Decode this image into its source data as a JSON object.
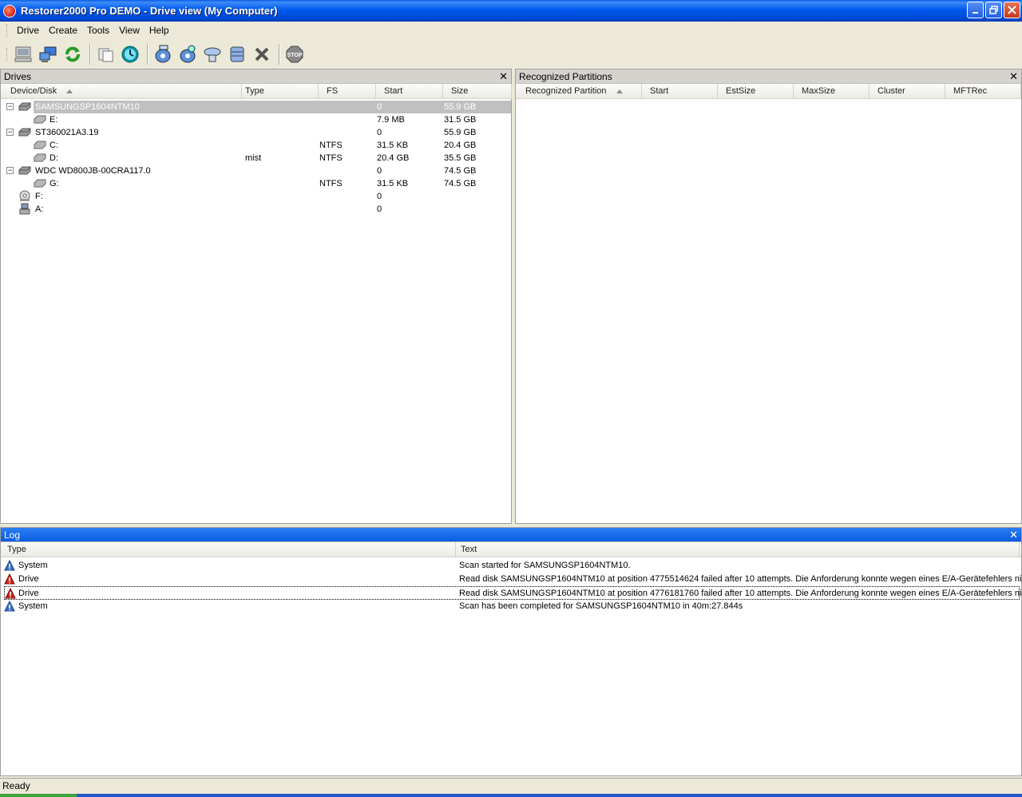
{
  "window": {
    "title": "Restorer2000 Pro DEMO - Drive view (My Computer)"
  },
  "menu": [
    "Drive",
    "Create",
    "Tools",
    "View",
    "Help"
  ],
  "toolbar": {
    "icons": [
      "computer-icon",
      "network-icon",
      "refresh-icon",
      "copy-icon",
      "scan-icon",
      "disk-open-icon",
      "disk-scan-icon",
      "disk-region-icon",
      "disk-image-icon",
      "delete-icon",
      "stop-icon"
    ]
  },
  "drives": {
    "title": "Drives",
    "columns": [
      "Device/Disk",
      "Type",
      "FS",
      "Start",
      "Size"
    ],
    "rows": [
      {
        "name": "SAMSUNGSP1604NTM10",
        "type": "",
        "fs": "",
        "start": "0",
        "size": "55.9 GB"
      },
      {
        "name": "E:",
        "type": "",
        "fs": "",
        "start": "7.9 MB",
        "size": "31.5 GB"
      },
      {
        "name": "ST360021A3.19",
        "type": "",
        "fs": "",
        "start": "0",
        "size": "55.9 GB"
      },
      {
        "name": "C:",
        "type": "",
        "fs": "NTFS",
        "start": "31.5 KB",
        "size": "20.4 GB"
      },
      {
        "name": "D:",
        "type": "mist",
        "fs": "NTFS",
        "start": "20.4 GB",
        "size": "35.5 GB"
      },
      {
        "name": "WDC WD800JB-00CRA117.0",
        "type": "",
        "fs": "",
        "start": "0",
        "size": "74.5 GB"
      },
      {
        "name": "G:",
        "type": "",
        "fs": "NTFS",
        "start": "31.5 KB",
        "size": "74.5 GB"
      },
      {
        "name": "F:",
        "type": "",
        "fs": "",
        "start": "0",
        "size": ""
      },
      {
        "name": "A:",
        "type": "",
        "fs": "",
        "start": "0",
        "size": ""
      }
    ]
  },
  "partitions": {
    "title": "Recognized Partitions",
    "columns": [
      "Recognized Partition",
      "Start",
      "EstSize",
      "MaxSize",
      "Cluster",
      "MFTRec"
    ]
  },
  "log": {
    "title": "Log",
    "columns": [
      "Type",
      "Text"
    ],
    "rows": [
      {
        "type": "System",
        "text": "Scan started for SAMSUNGSP1604NTM10."
      },
      {
        "type": "Drive",
        "text": "Read disk SAMSUNGSP1604NTM10 at position 4775514624 failed after 10 attempts. Die Anforderung konnte wegen eines E/A-Gerätefehlers ni..."
      },
      {
        "type": "Drive",
        "text": "Read disk SAMSUNGSP1604NTM10 at position 4776181760 failed after 10 attempts. Die Anforderung konnte wegen eines E/A-Gerätefehlers ni..."
      },
      {
        "type": "System",
        "text": "Scan has been completed for SAMSUNGSP1604NTM10 in 40m:27.844s"
      }
    ]
  },
  "status": {
    "text": "Ready"
  }
}
